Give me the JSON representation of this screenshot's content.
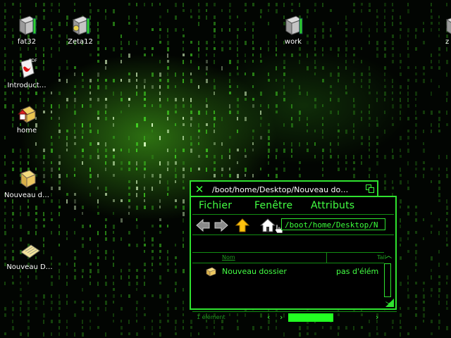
{
  "desktop": {
    "icons": [
      {
        "name": "fat32",
        "label": "fat32"
      },
      {
        "name": "zeta12",
        "label": "Zeta12"
      },
      {
        "name": "work",
        "label": "work"
      },
      {
        "name": "zeta-partial",
        "label": "z"
      },
      {
        "name": "introduction-pdf",
        "label": "Introduct…",
        "badge": "PDF"
      },
      {
        "name": "home",
        "label": "home"
      },
      {
        "name": "nouveau-dossier",
        "label": "Nouveau d…"
      },
      {
        "name": "nouveau-document",
        "label": "Nouveau D…"
      }
    ],
    "background_color": "#020502",
    "accent": "#2fe12f"
  },
  "tracker": {
    "title": "/boot/home/Desktop/Nouveau do…",
    "menu": [
      "Fichier",
      "Fenêtre",
      "Attributs"
    ],
    "toolbar": {
      "back_icon": "back-arrow-icon",
      "forward_icon": "forward-arrow-icon",
      "up_icon": "up-arrow-icon",
      "home_icon": "home-icon",
      "path": "/boot/home/Desktop/N"
    },
    "columns": {
      "name": "Nom",
      "size": "Tail"
    },
    "rows": [
      {
        "name": "Nouveau dossier",
        "size": "pas d'élém"
      }
    ],
    "status": "1 élément"
  },
  "colors": {
    "accent_green": "#2fe12f",
    "text_green": "#43ff43",
    "dim_green": "#1f9c1f",
    "background": "#000000"
  }
}
